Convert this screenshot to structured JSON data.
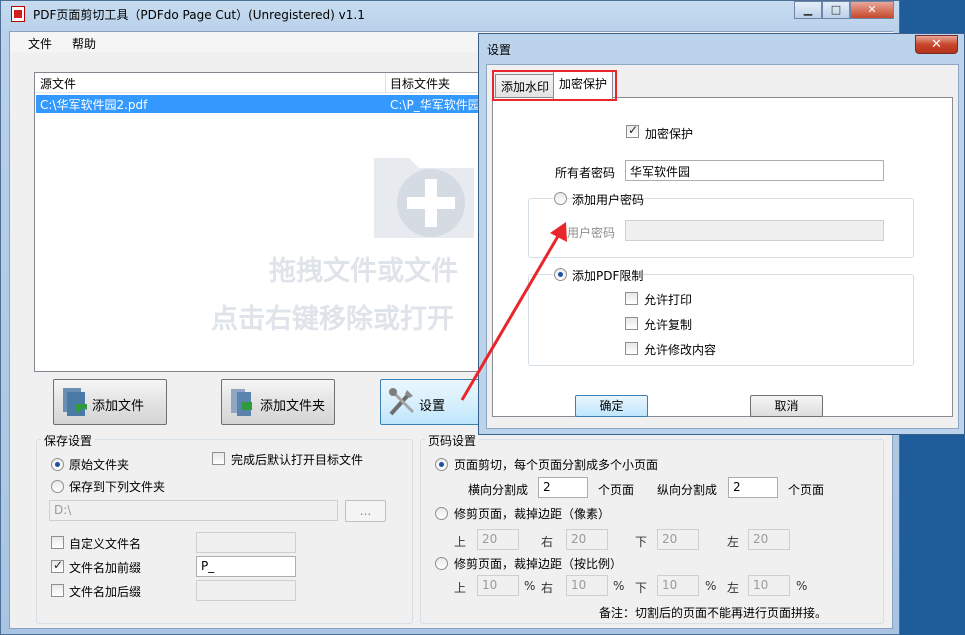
{
  "main_window": {
    "title": "PDF页面剪切工具（PDFdo Page Cut）(Unregistered) v1.1",
    "minimize": "▁",
    "maximize": "□",
    "close": "✕",
    "menu": [
      "文件",
      "帮助"
    ]
  },
  "file_list": {
    "columns": [
      "源文件",
      "目标文件夹"
    ],
    "rows": [
      {
        "source": "C:\\华军软件园2.pdf",
        "target": "C:\\P_华军软件园"
      }
    ],
    "watermark_line1": "拖拽文件或文件",
    "watermark_line2": "点击右键移除或打开"
  },
  "buttons": {
    "add_file": "添加文件",
    "add_folder": "添加文件夹",
    "settings": "设置"
  },
  "save_settings": {
    "title": "保存设置",
    "original_folder": "原始文件夹",
    "save_to_folder": "保存到下列文件夹",
    "open_after": "完成后默认打开目标文件",
    "folder_path": "D:\\",
    "browse": "...",
    "custom_name": "自定义文件名",
    "prefix_label": "文件名加前缀",
    "prefix_value": "P_",
    "suffix_label": "文件名加后缀"
  },
  "page_settings": {
    "title": "页码设置",
    "option1": "页面剪切，每个页面分割成多个小页面",
    "h_split_label": "横向分割成",
    "h_split_value": "2",
    "v_split_label": "纵向分割成",
    "v_split_value": "2",
    "pages_unit": "个页面",
    "option2": "修剪页面，裁掉边距（像素）",
    "option3": "修剪页面，裁掉边距（按比例）",
    "top": "上",
    "right": "右",
    "bottom": "下",
    "left": "左",
    "px_value": "20",
    "pct_value": "10",
    "percent": "%",
    "note": "备注：切割后的页面不能再进行页面拼接。"
  },
  "dialog": {
    "title": "设置",
    "close": "✕",
    "tabs": [
      "添加水印",
      "加密保护"
    ],
    "encrypt_label": "加密保护",
    "owner_pwd_label": "所有者密码",
    "owner_pwd_value": "华军软件园",
    "add_user_pwd": "添加用户密码",
    "user_pwd_label": "用户密码",
    "add_pdf_restrict": "添加PDF限制",
    "allow_print": "允许打印",
    "allow_copy": "允许复制",
    "allow_modify": "允许修改内容",
    "ok": "确定",
    "cancel": "取消"
  },
  "colors": {
    "highlight": "#e8262c",
    "selection": "#3399ff"
  }
}
